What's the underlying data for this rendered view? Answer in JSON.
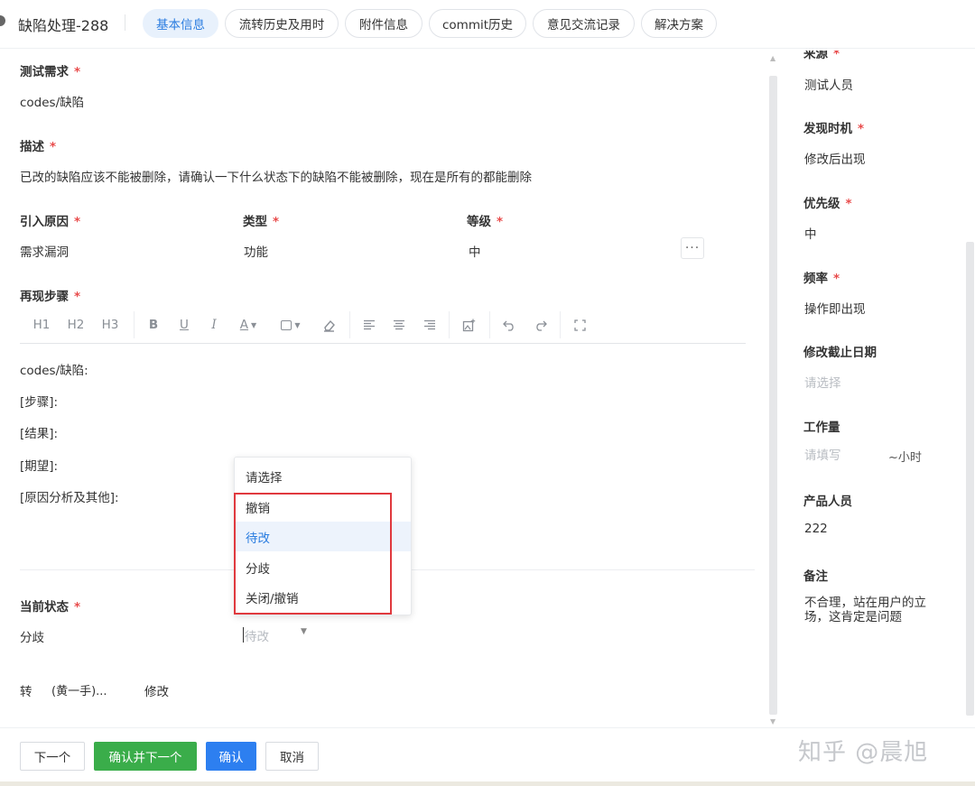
{
  "header": {
    "title": "缺陷处理-288",
    "tabs": [
      "基本信息",
      "流转历史及用时",
      "附件信息",
      "commit历史",
      "意见交流记录",
      "解决方案"
    ]
  },
  "main": {
    "test_req_label": "测试需求",
    "test_req_value": "codes/缺陷",
    "desc_label": "描述",
    "desc_value": "已改的缺陷应该不能被删除，请确认一下什么状态下的缺陷不能被删除，现在是所有的都能删除",
    "cause_label": "引入原因",
    "cause_value": "需求漏洞",
    "type_label": "类型",
    "type_value": "功能",
    "level_label": "等级",
    "level_value": "中",
    "more": "···",
    "steps_label": "再现步骤",
    "toolbar": [
      "H1",
      "H2",
      "H3"
    ],
    "editor_lines": [
      "codes/缺陷:",
      "[步骤]:",
      "[结果]:",
      "[期望]:",
      "[原因分析及其他]:"
    ],
    "status_label": "当前状态",
    "status_value": "分歧",
    "status_select_value": "待改",
    "transfer_label": "转",
    "transfer_value": "(黄一手)...",
    "edit_label": "修改",
    "required_mark": "*"
  },
  "dropdown": {
    "options": [
      "请选择",
      "撤销",
      "待改",
      "分歧",
      "关闭/撤销"
    ],
    "highlighted": "待改"
  },
  "side": {
    "source_label": "来源",
    "source_value": "测试人员",
    "found_label": "发现时机",
    "found_value": "修改后出现",
    "priority_label": "优先级",
    "priority_value": "中",
    "freq_label": "频率",
    "freq_value": "操作即出现",
    "deadline_label": "修改截止日期",
    "deadline_placeholder": "请选择",
    "workload_label": "工作量",
    "workload_placeholder": "请填写",
    "workload_unit": "~小时",
    "product_label": "产品人员",
    "product_value": "222",
    "notes_label": "备注",
    "notes_value": "不合理，站在用户的立场，这肯定是问题"
  },
  "footer": {
    "next": "下一个",
    "confirm_next": "确认并下一个",
    "confirm": "确认",
    "cancel": "取消",
    "watermark": "知乎 @晨旭"
  },
  "colors": {
    "accent": "#2b7de0",
    "required": "#e84b4b",
    "green": "#3aad4a",
    "highlight_box": "#e0393e"
  }
}
